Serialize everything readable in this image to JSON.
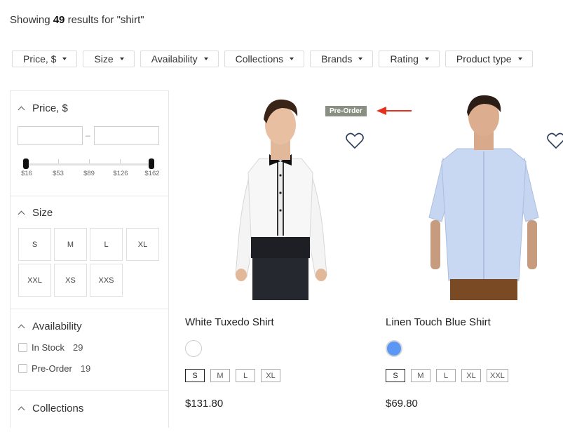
{
  "results": {
    "prefix": "Showing",
    "count": "49",
    "suffix": "results for \"shirt\""
  },
  "filters": [
    "Price, $",
    "Size",
    "Availability",
    "Collections",
    "Brands",
    "Rating",
    "Product type"
  ],
  "sidebar": {
    "price": {
      "title": "Price, $",
      "ticks": [
        "$16",
        "$53",
        "$89",
        "$126",
        "$162"
      ]
    },
    "size": {
      "title": "Size",
      "options": [
        "S",
        "M",
        "L",
        "XL",
        "XXL",
        "XS",
        "XXS"
      ]
    },
    "availability": {
      "title": "Availability",
      "options": [
        {
          "label": "In Stock",
          "count": "29"
        },
        {
          "label": "Pre-Order",
          "count": "19"
        }
      ]
    },
    "collections": {
      "title": "Collections"
    }
  },
  "products": [
    {
      "name": "White Tuxedo Shirt",
      "price": "$131.80",
      "badge": "Pre-Order",
      "swatch": "#ffffff",
      "sizes": [
        "S",
        "M",
        "L",
        "XL"
      ],
      "selected_size": "S"
    },
    {
      "name": "Linen Touch Blue Shirt",
      "price": "$69.80",
      "swatch": "#5b97f5",
      "sizes": [
        "S",
        "M",
        "L",
        "XL",
        "XXL"
      ],
      "selected_size": "S"
    }
  ],
  "colors": {
    "badge": "#8a8f84",
    "arrow": "#e8311c",
    "heart": "#2a3b55"
  }
}
